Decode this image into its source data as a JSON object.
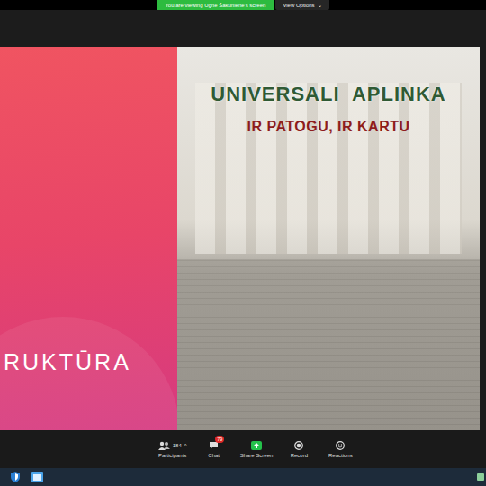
{
  "banner": {
    "text": "You are viewing Ugnė Šakūnienė's screen",
    "button": "View Options",
    "button_icon": "⌄"
  },
  "slide": {
    "left_text": "RUKTŪRA",
    "title": "UNIVERSALI  APLINKA",
    "subtitle": "IR PATOGU, IR KARTU"
  },
  "toolbar": {
    "items": [
      {
        "label": "Participants",
        "kind": "participants",
        "count": "184",
        "caret": "^",
        "badge": ""
      },
      {
        "label": "Chat",
        "kind": "chat",
        "count": "",
        "caret": "",
        "badge": "79"
      },
      {
        "label": "Share Screen",
        "kind": "share",
        "count": "",
        "caret": "",
        "badge": ""
      },
      {
        "label": "Record",
        "kind": "record",
        "count": "",
        "caret": "",
        "badge": ""
      },
      {
        "label": "Reactions",
        "kind": "reactions",
        "count": "",
        "caret": "",
        "badge": ""
      }
    ]
  }
}
